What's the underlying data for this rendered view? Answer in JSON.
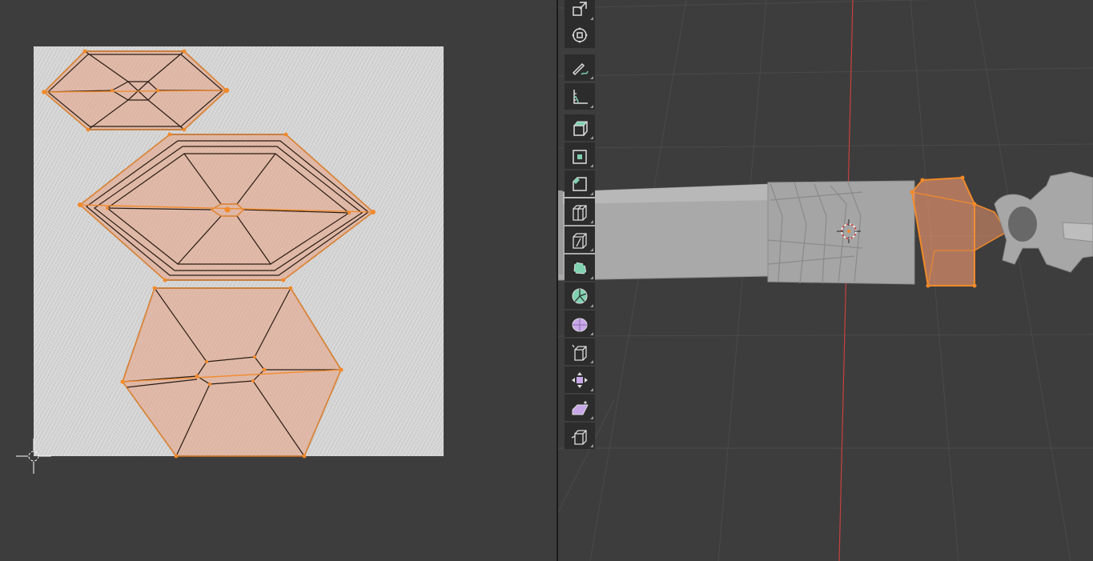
{
  "uv_editor": {
    "image": "uv-texture-grey-noise"
  },
  "viewport": {
    "selection_color": "#f28a2a",
    "x_axis_color": "#c84040"
  },
  "toolbar": {
    "tools": [
      {
        "name": "scale",
        "icon": "scale-icon",
        "active": false
      },
      {
        "name": "transform",
        "icon": "transform-icon",
        "active": false
      },
      {
        "name": "annotate",
        "icon": "annotate-icon",
        "active": false
      },
      {
        "name": "measure",
        "icon": "measure-icon",
        "active": false
      },
      {
        "name": "extrude-region",
        "icon": "extrude-region-icon",
        "active": false
      },
      {
        "name": "inset-faces",
        "icon": "inset-faces-icon",
        "active": false
      },
      {
        "name": "bevel",
        "icon": "bevel-icon",
        "active": false
      },
      {
        "name": "loop-cut",
        "icon": "loop-cut-icon",
        "active": false
      },
      {
        "name": "knife",
        "icon": "knife-icon",
        "active": false
      },
      {
        "name": "poly-build",
        "icon": "poly-build-icon",
        "active": false
      },
      {
        "name": "spin",
        "icon": "spin-icon",
        "active": false
      },
      {
        "name": "smooth",
        "icon": "smooth-icon",
        "active": false
      },
      {
        "name": "edge-slide",
        "icon": "edge-slide-icon",
        "active": false
      },
      {
        "name": "shrink-fatten",
        "icon": "shrink-fatten-icon",
        "active": false
      },
      {
        "name": "shear",
        "icon": "shear-icon",
        "active": false
      },
      {
        "name": "rip-region",
        "icon": "rip-region-icon",
        "active": false
      }
    ]
  }
}
